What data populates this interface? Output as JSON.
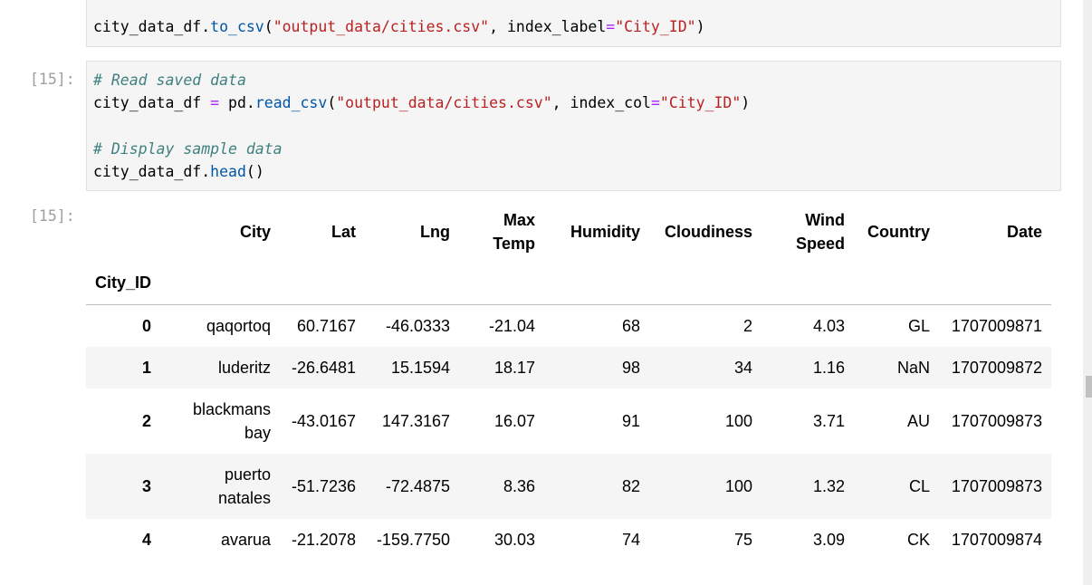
{
  "cells": {
    "cell_top": {
      "line1": {
        "p1": "city_data_df.",
        "fn": "to_csv",
        "p2": "(",
        "s1": "\"output_data/cities.csv\"",
        "p3": ", index_label",
        "op": "=",
        "s2": "\"City_ID\"",
        "p4": ")"
      }
    },
    "cell_15": {
      "prompt": "[15]:",
      "comment1": "# Read saved data",
      "line2": {
        "p1": "city_data_df ",
        "op1": "=",
        "p2": " pd.",
        "fn": "read_csv",
        "p3": "(",
        "s1": "\"output_data/cities.csv\"",
        "p4": ", index_col",
        "op2": "=",
        "s2": "\"City_ID\"",
        "p5": ")"
      },
      "comment2": "# Display sample data",
      "line4": {
        "p1": "city_data_df.",
        "fn": "head",
        "p2": "()"
      }
    },
    "output_15": {
      "prompt": "[15]:"
    }
  },
  "table": {
    "columns": [
      "City",
      "Lat",
      "Lng",
      "Max Temp",
      "Humidity",
      "Cloudiness",
      "Wind Speed",
      "Country",
      "Date"
    ],
    "index_name": "City_ID",
    "rows": [
      {
        "idx": "0",
        "city": "qaqortoq",
        "lat": "60.7167",
        "lng": "-46.0333",
        "max_temp": "-21.04",
        "humidity": "68",
        "cloudiness": "2",
        "wind_speed": "4.03",
        "country": "GL",
        "date": "1707009871"
      },
      {
        "idx": "1",
        "city": "luderitz",
        "lat": "-26.6481",
        "lng": "15.1594",
        "max_temp": "18.17",
        "humidity": "98",
        "cloudiness": "34",
        "wind_speed": "1.16",
        "country": "NaN",
        "date": "1707009872"
      },
      {
        "idx": "2",
        "city": "blackmans bay",
        "lat": "-43.0167",
        "lng": "147.3167",
        "max_temp": "16.07",
        "humidity": "91",
        "cloudiness": "100",
        "wind_speed": "3.71",
        "country": "AU",
        "date": "1707009873"
      },
      {
        "idx": "3",
        "city": "puerto natales",
        "lat": "-51.7236",
        "lng": "-72.4875",
        "max_temp": "8.36",
        "humidity": "82",
        "cloudiness": "100",
        "wind_speed": "1.32",
        "country": "CL",
        "date": "1707009873"
      },
      {
        "idx": "4",
        "city": "avarua",
        "lat": "-21.2078",
        "lng": "-159.7750",
        "max_temp": "30.03",
        "humidity": "74",
        "cloudiness": "75",
        "wind_speed": "3.09",
        "country": "CK",
        "date": "1707009874"
      }
    ]
  }
}
